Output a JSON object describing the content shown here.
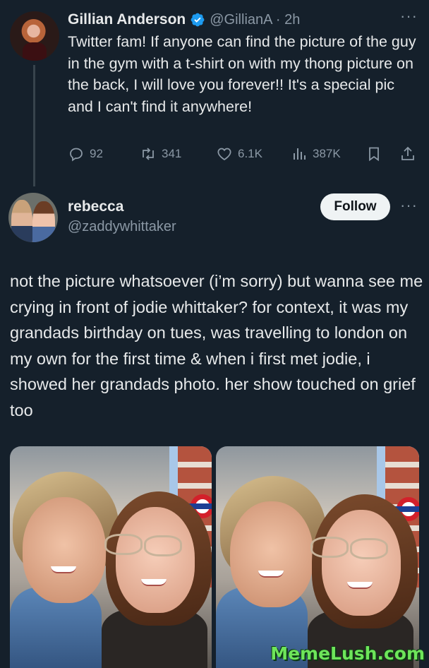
{
  "tweet": {
    "author_name": "Gillian Anderson",
    "handle_time": "@GillianA · 2h",
    "text": "Twitter fam! If anyone can find the picture of the guy in the gym with a t-shirt on with my thong picture on the back, I will love you forever!! It's a special pic and I can't find it anywhere!",
    "actions": {
      "replies": "92",
      "retweets": "341",
      "likes": "6.1K",
      "views": "387K"
    },
    "more": "···"
  },
  "reply": {
    "author_name": "rebecca",
    "handle": "@zaddywhittaker",
    "follow_label": "Follow",
    "more": "···",
    "text": "not the picture whatsoever (i’m sorry) but wanna see me crying in front of jodie whittaker? for context, it was my grandads birthday on tues, was travelling to london on my own for the first time & when i first met jodie, i showed her grandads photo. her show touched on grief too"
  },
  "watermark": "MemeLush.com",
  "colors": {
    "background": "#15202b",
    "verified": "#1d9bf0",
    "muted": "#8b98a5",
    "watermark": "#6ee55a"
  },
  "icons": [
    "reply-icon",
    "retweet-icon",
    "like-icon",
    "views-icon",
    "bookmark-icon",
    "share-icon",
    "verified-badge-icon"
  ]
}
